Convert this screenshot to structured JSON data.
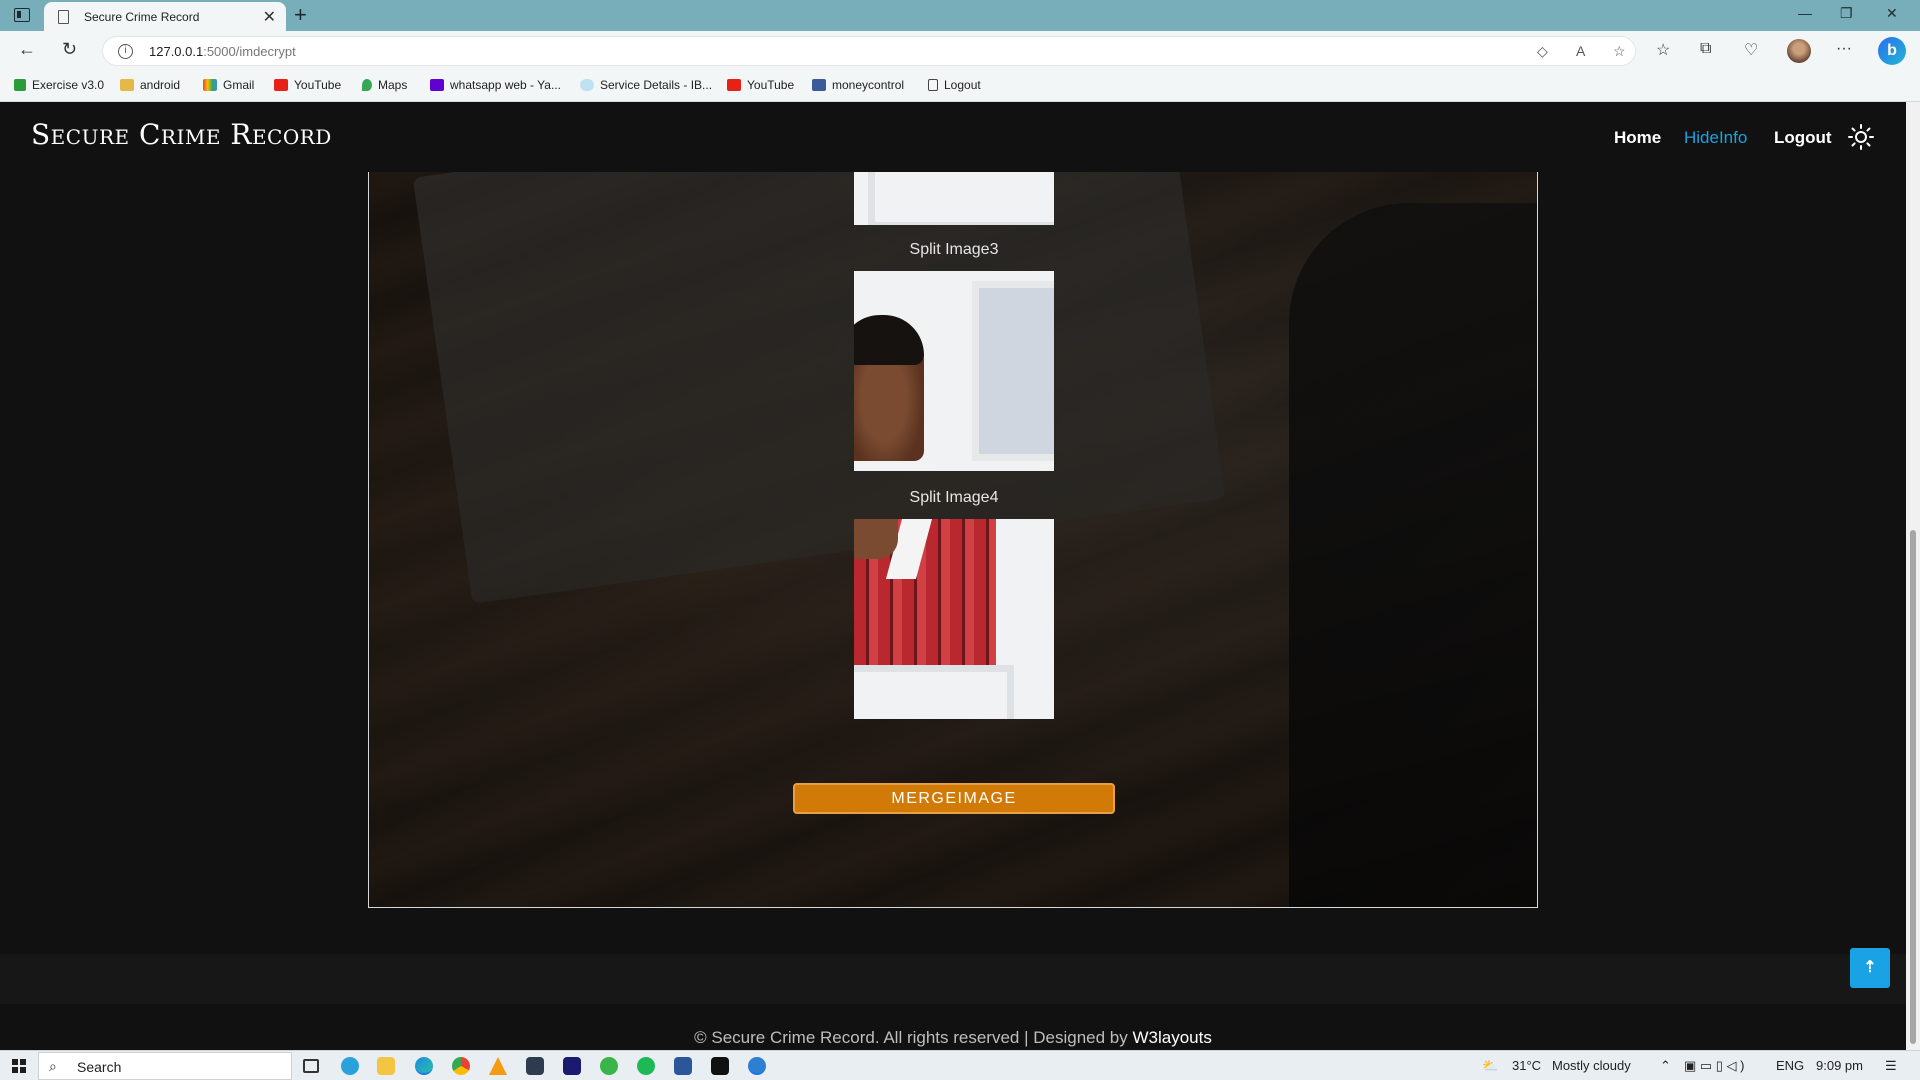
{
  "browser": {
    "tab_title": "Secure Crime Record",
    "url_host": "127.0.0.1",
    "url_path": ":5000/imdecrypt",
    "bookmarks": [
      "Exercise v3.0",
      "android",
      "Gmail",
      "YouTube",
      "Maps",
      "whatsapp web - Ya...",
      "Service Details - IB...",
      "YouTube",
      "moneycontrol",
      "Logout"
    ]
  },
  "site": {
    "brand": "Secure Crime Record",
    "nav": {
      "home": "Home",
      "hideinfo": "HideInfo",
      "logout": "Logout"
    },
    "accent": "#1aa3e4"
  },
  "content": {
    "caption3": "Split Image3",
    "caption4": "Split Image4",
    "merge_button": "MERGEIMAGE",
    "merge_color": "#d27a08"
  },
  "footer": {
    "text": "© Secure Crime Record. All rights reserved | Designed by",
    "link": "W3layouts"
  },
  "taskbar": {
    "search": "Search",
    "temperature": "31°C",
    "weather": "Mostly cloudy",
    "language": "ENG",
    "time": "9:09 pm"
  }
}
